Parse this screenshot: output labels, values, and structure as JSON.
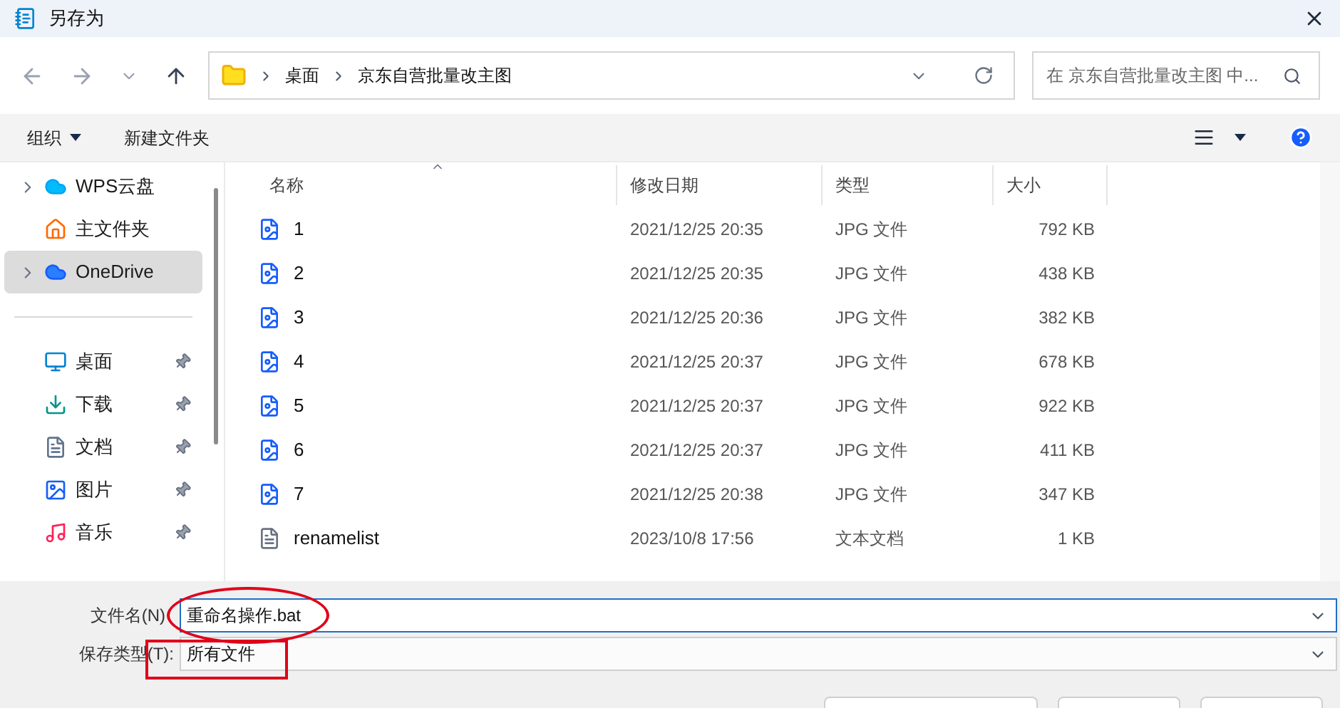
{
  "window": {
    "title": "另存为"
  },
  "nav": {
    "path": [
      "桌面",
      "京东自营批量改主图"
    ],
    "search_placeholder": "在 京东自营批量改主图 中..."
  },
  "toolbar": {
    "organize": "组织",
    "new_folder": "新建文件夹"
  },
  "sidebar": {
    "items": [
      {
        "label": "WPS云盘",
        "kind": "cloud",
        "expandable": true,
        "selected": false,
        "pinned": false
      },
      {
        "label": "主文件夹",
        "kind": "home",
        "expandable": false,
        "selected": false,
        "pinned": false
      },
      {
        "label": "OneDrive",
        "kind": "onedrive",
        "expandable": true,
        "selected": true,
        "pinned": false
      },
      {
        "label": "桌面",
        "kind": "desktop",
        "expandable": false,
        "selected": false,
        "pinned": true
      },
      {
        "label": "下载",
        "kind": "download",
        "expandable": false,
        "selected": false,
        "pinned": true
      },
      {
        "label": "文档",
        "kind": "documents",
        "expandable": false,
        "selected": false,
        "pinned": true
      },
      {
        "label": "图片",
        "kind": "pictures",
        "expandable": false,
        "selected": false,
        "pinned": true
      },
      {
        "label": "音乐",
        "kind": "music",
        "expandable": false,
        "selected": false,
        "pinned": true
      }
    ]
  },
  "table": {
    "columns": [
      "名称",
      "修改日期",
      "类型",
      "大小"
    ],
    "rows": [
      {
        "kind": "image",
        "name": "1",
        "date": "2021/12/25 20:35",
        "type": "JPG 文件",
        "size": "792 KB"
      },
      {
        "kind": "image",
        "name": "2",
        "date": "2021/12/25 20:35",
        "type": "JPG 文件",
        "size": "438 KB"
      },
      {
        "kind": "image",
        "name": "3",
        "date": "2021/12/25 20:36",
        "type": "JPG 文件",
        "size": "382 KB"
      },
      {
        "kind": "image",
        "name": "4",
        "date": "2021/12/25 20:37",
        "type": "JPG 文件",
        "size": "678 KB"
      },
      {
        "kind": "image",
        "name": "5",
        "date": "2021/12/25 20:37",
        "type": "JPG 文件",
        "size": "922 KB"
      },
      {
        "kind": "image",
        "name": "6",
        "date": "2021/12/25 20:37",
        "type": "JPG 文件",
        "size": "411 KB"
      },
      {
        "kind": "image",
        "name": "7",
        "date": "2021/12/25 20:38",
        "type": "JPG 文件",
        "size": "347 KB"
      },
      {
        "kind": "text",
        "name": "renamelist",
        "date": "2023/10/8 17:56",
        "type": "文本文档",
        "size": "1 KB"
      }
    ]
  },
  "form": {
    "filename": {
      "label": "文件名(N)",
      "value": "重命名操作.bat"
    },
    "filetype": {
      "label": "保存类型(T):",
      "value": "所有文件"
    }
  }
}
